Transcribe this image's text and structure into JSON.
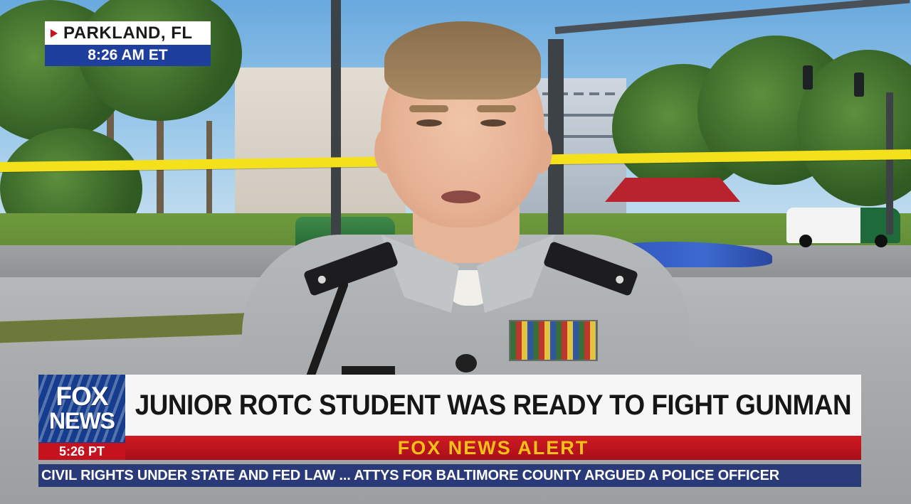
{
  "location_bug": {
    "city": "PARKLAND, FL",
    "time": "8:26 AM ET"
  },
  "network": {
    "logo_line1": "FOX",
    "logo_line2": "NEWS",
    "local_time": "5:26 PT"
  },
  "lower_third": {
    "headline": "JUNIOR ROTC STUDENT WAS READY TO FIGHT GUNMAN",
    "alert": "FOX NEWS ALERT"
  },
  "ticker": {
    "text": "CIVIL RIGHTS UNDER STATE AND FED LAW ... ATTYS FOR BALTIMORE COUNTY ARGUED A POLICE OFFICER"
  },
  "colors": {
    "fox_blue": "#163d8d",
    "alert_red": "#c4121f",
    "alert_text": "#f5c118",
    "caution_tape": "#f4e11b"
  }
}
